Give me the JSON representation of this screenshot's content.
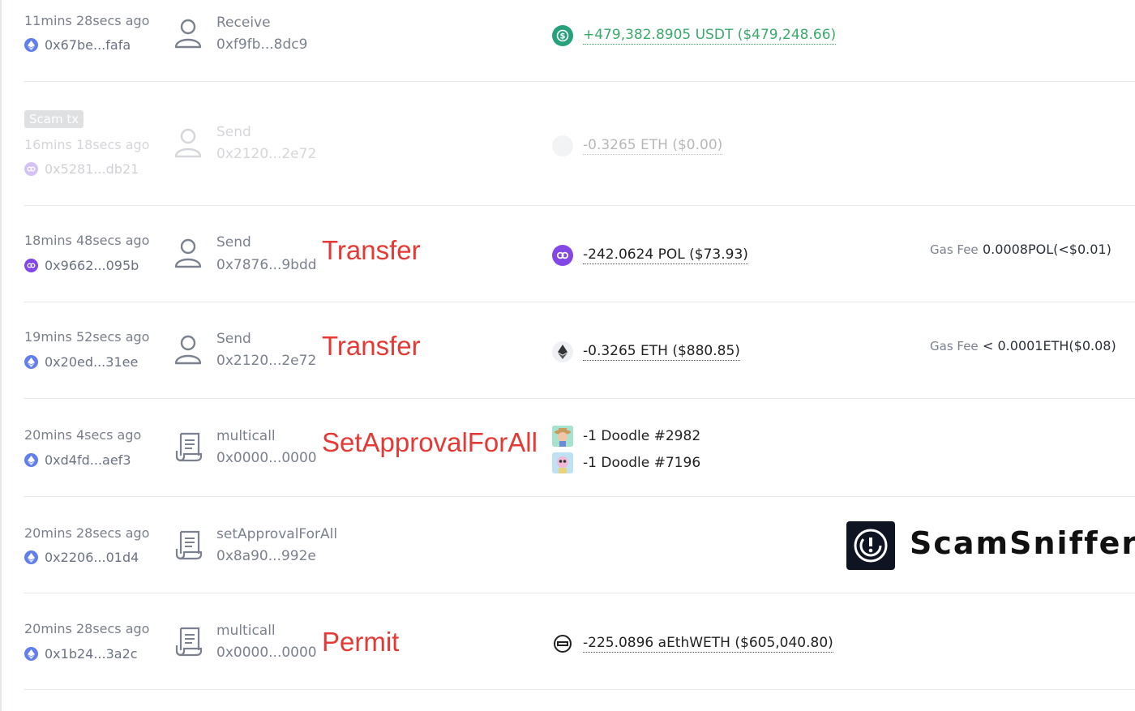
{
  "scam_badge": "Scam tx",
  "gas_fee_label": "Gas Fee",
  "colors": {
    "annotation": "#e53935",
    "receive_amount": "#3aaa6b",
    "eth_chain": "#627eea",
    "polygon_chain": "#8247e5",
    "usdt": "#26a17b"
  },
  "brand": {
    "name": "ScamSniffer",
    "logo_icon": "radar-shield-icon"
  },
  "rows": [
    {
      "time": "11mins 28secs ago",
      "hash": "0x67be...fafa",
      "chain_icon": "ethereum-icon",
      "method": "Receive",
      "address": "0xf9fb...8dc9",
      "annotation": "",
      "token_icon": "usdt-icon",
      "amount": "+479,382.8905 USDT ($479,248.66)",
      "gas_value": ""
    },
    {
      "time": "16mins 18secs ago",
      "hash": "0x5281...db21",
      "chain_icon": "polygon-icon",
      "method": "Send",
      "address": "0x2120...2e72",
      "annotation": "",
      "token_icon": "blank-token-icon",
      "amount": "-0.3265 ETH ($0.00)",
      "gas_value": ""
    },
    {
      "time": "18mins 48secs ago",
      "hash": "0x9662...095b",
      "chain_icon": "polygon-icon",
      "method": "Send",
      "address": "0x7876...9bdd",
      "annotation": "Transfer",
      "token_icon": "polygon-icon",
      "amount": "-242.0624 POL ($73.93)",
      "gas_value": "0.0008POL(<$0.01)"
    },
    {
      "time": "19mins 52secs ago",
      "hash": "0x20ed...31ee",
      "chain_icon": "ethereum-icon",
      "method": "Send",
      "address": "0x2120...2e72",
      "annotation": "Transfer",
      "token_icon": "ethereum-icon",
      "amount": "-0.3265 ETH ($880.85)",
      "gas_value": "< 0.0001ETH($0.08)"
    },
    {
      "time": "20mins 4secs ago",
      "hash": "0xd4fd...aef3",
      "chain_icon": "ethereum-icon",
      "method": "multicall",
      "address": "0x0000...0000",
      "annotation": "SetApprovalForAll",
      "nfts": [
        "-1 Doodle #2982",
        "-1 Doodle #7196"
      ]
    },
    {
      "time": "20mins 28secs ago",
      "hash": "0x2206...01d4",
      "chain_icon": "ethereum-icon",
      "method": "setApprovalForAll",
      "address": "0x8a90...992e",
      "annotation": ""
    },
    {
      "time": "20mins 28secs ago",
      "hash": "0x1b24...3a2c",
      "chain_icon": "ethereum-icon",
      "method": "multicall",
      "address": "0x0000...0000",
      "annotation": "Permit",
      "token_icon": "weth-icon",
      "amount": "-225.0896 aEthWETH ($605,040.80)"
    }
  ]
}
